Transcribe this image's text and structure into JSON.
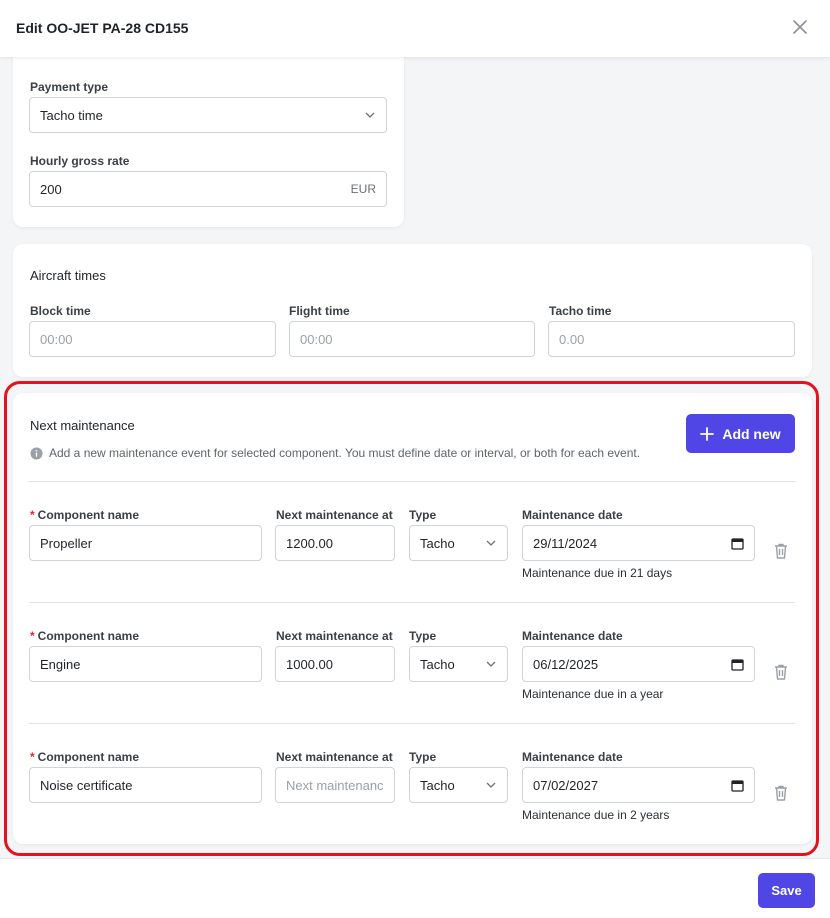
{
  "header": {
    "title": "Edit OO-JET PA-28 CD155",
    "close_icon": "close-icon"
  },
  "payment": {
    "payment_type_label": "Payment type",
    "payment_type_value": "Tacho time",
    "hourly_rate_label": "Hourly gross rate",
    "hourly_rate_value": "200",
    "currency": "EUR"
  },
  "aircraft_times": {
    "title": "Aircraft times",
    "block_label": "Block time",
    "block_placeholder": "00:00",
    "flight_label": "Flight time",
    "flight_placeholder": "00:00",
    "tacho_label": "Tacho time",
    "tacho_placeholder": "0.00"
  },
  "maintenance": {
    "title": "Next maintenance",
    "info": "Add a new maintenance event for selected component. You must define date or interval, or both for each event.",
    "add_label": "Add new",
    "col_component": "Component name",
    "col_next": "Next maintenance at",
    "col_type": "Type",
    "col_date": "Maintenance date",
    "next_placeholder": "Next maintenanc",
    "rows": [
      {
        "component": "Propeller",
        "next": "1200.00",
        "type": "Tacho",
        "date": "29/11/2024",
        "due": "Maintenance due in 21 days"
      },
      {
        "component": "Engine",
        "next": "1000.00",
        "type": "Tacho",
        "date": "06/12/2025",
        "due": "Maintenance due in a year"
      },
      {
        "component": "Noise certificate",
        "next": "",
        "type": "Tacho",
        "date": "07/02/2027",
        "due": "Maintenance due in 2 years"
      }
    ]
  },
  "footer": {
    "save_label": "Save"
  },
  "colors": {
    "accent": "#4f46e5",
    "highlight": "#e3121c",
    "required": "#d92d2d"
  }
}
